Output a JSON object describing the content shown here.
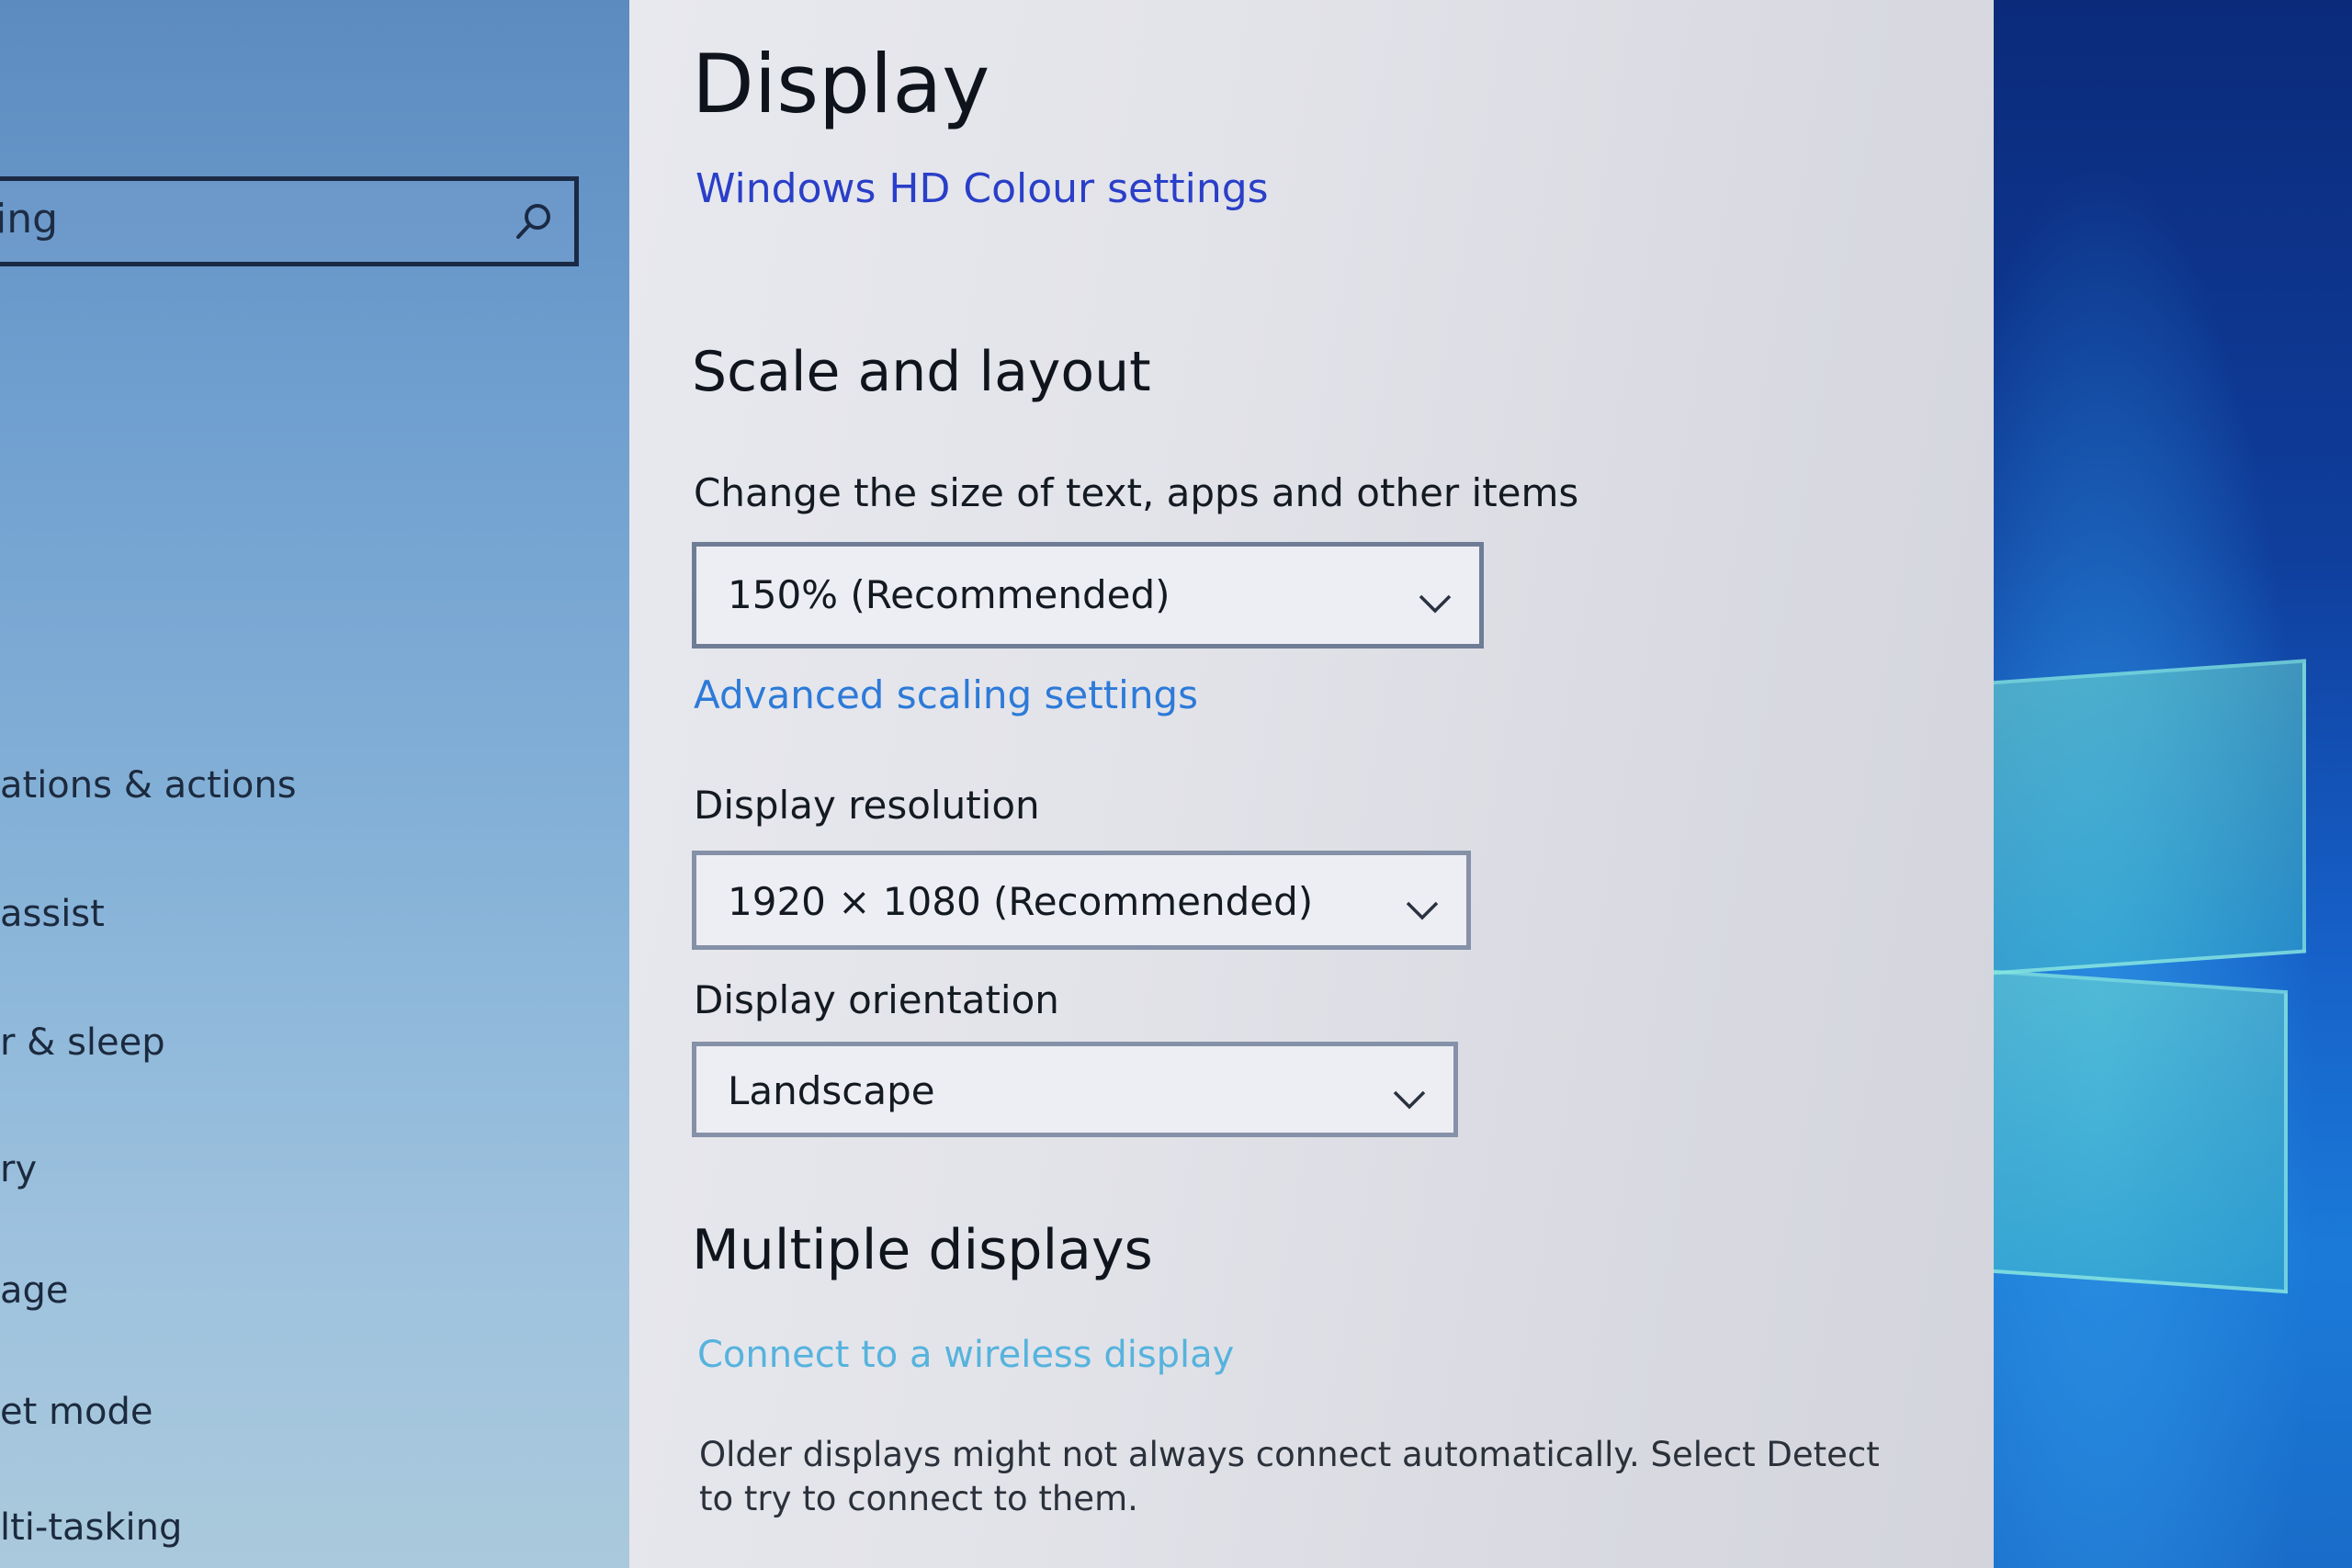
{
  "sidebar": {
    "search": {
      "value": "ing",
      "icon": "search-icon"
    },
    "items": [
      {
        "label": "ations & actions"
      },
      {
        "label": "assist"
      },
      {
        "label": "r & sleep"
      },
      {
        "label": "ry"
      },
      {
        "label": "age"
      },
      {
        "label": "et mode"
      },
      {
        "label": "lti-tasking"
      }
    ]
  },
  "main": {
    "title": "Display",
    "hd_colour_link": "Windows HD Colour settings",
    "scale_section": {
      "heading": "Scale and layout",
      "size_label": "Change the size of text, apps and other items",
      "size_value": "150% (Recommended)",
      "advanced_link": "Advanced scaling settings",
      "resolution_label": "Display resolution",
      "resolution_value": "1920 × 1080 (Recommended)",
      "orientation_label": "Display orientation",
      "orientation_value": "Landscape"
    },
    "multiple_section": {
      "heading": "Multiple displays",
      "wireless_link": "Connect to a wireless display",
      "older_text": "Older displays might not always connect automatically. Select Detect to try to connect to them."
    }
  },
  "colors": {
    "link": "#1a4fcf",
    "link_light": "#56b3dd",
    "panel_bg": "#e2e3e9",
    "desktop_blue": "#0f3e9c"
  }
}
